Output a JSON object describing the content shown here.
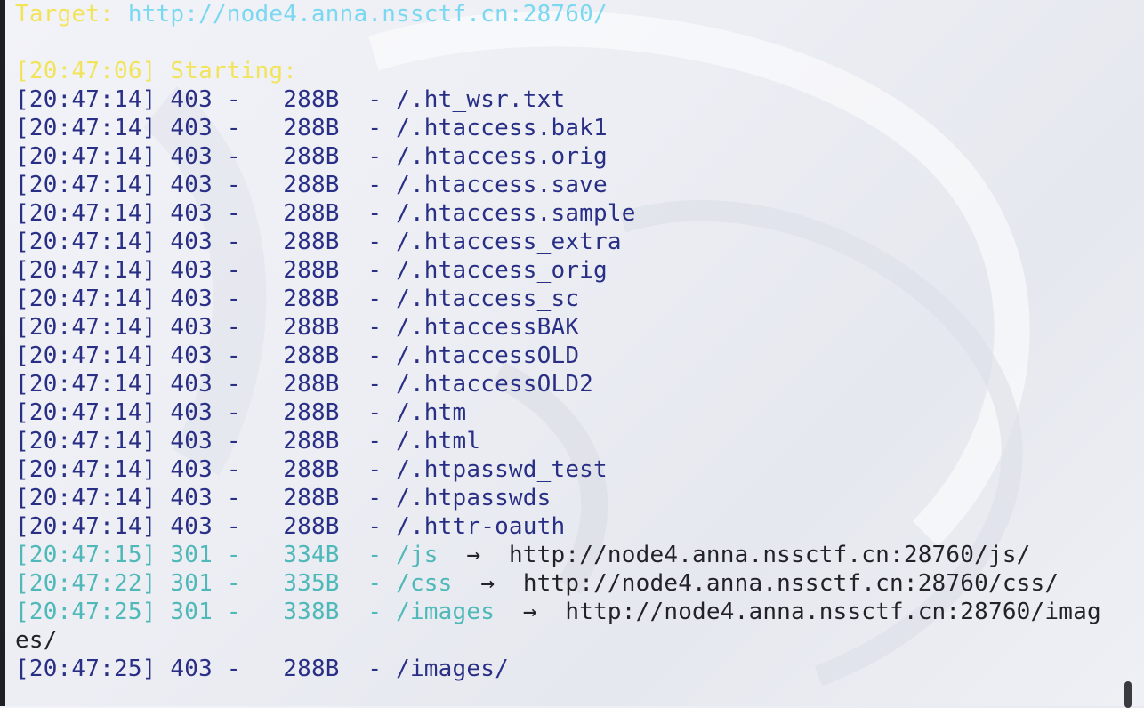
{
  "target": {
    "label": "Target: ",
    "url": "http://node4.anna.nssctf.cn:28760/"
  },
  "start_line": "[20:47:06] Starting:",
  "entries": [
    {
      "time": "[20:47:14]",
      "code": "403",
      "size": "288B",
      "path": "/.ht_wsr.txt"
    },
    {
      "time": "[20:47:14]",
      "code": "403",
      "size": "288B",
      "path": "/.htaccess.bak1"
    },
    {
      "time": "[20:47:14]",
      "code": "403",
      "size": "288B",
      "path": "/.htaccess.orig"
    },
    {
      "time": "[20:47:14]",
      "code": "403",
      "size": "288B",
      "path": "/.htaccess.save"
    },
    {
      "time": "[20:47:14]",
      "code": "403",
      "size": "288B",
      "path": "/.htaccess.sample"
    },
    {
      "time": "[20:47:14]",
      "code": "403",
      "size": "288B",
      "path": "/.htaccess_extra"
    },
    {
      "time": "[20:47:14]",
      "code": "403",
      "size": "288B",
      "path": "/.htaccess_orig"
    },
    {
      "time": "[20:47:14]",
      "code": "403",
      "size": "288B",
      "path": "/.htaccess_sc"
    },
    {
      "time": "[20:47:14]",
      "code": "403",
      "size": "288B",
      "path": "/.htaccessBAK"
    },
    {
      "time": "[20:47:14]",
      "code": "403",
      "size": "288B",
      "path": "/.htaccessOLD"
    },
    {
      "time": "[20:47:14]",
      "code": "403",
      "size": "288B",
      "path": "/.htaccessOLD2"
    },
    {
      "time": "[20:47:14]",
      "code": "403",
      "size": "288B",
      "path": "/.htm"
    },
    {
      "time": "[20:47:14]",
      "code": "403",
      "size": "288B",
      "path": "/.html"
    },
    {
      "time": "[20:47:14]",
      "code": "403",
      "size": "288B",
      "path": "/.htpasswd_test"
    },
    {
      "time": "[20:47:14]",
      "code": "403",
      "size": "288B",
      "path": "/.htpasswds"
    },
    {
      "time": "[20:47:14]",
      "code": "403",
      "size": "288B",
      "path": "/.httr-oauth"
    }
  ],
  "redirects": [
    {
      "time": "[20:47:15]",
      "code": "301",
      "size": "334B",
      "path": "/js",
      "arrow": "→",
      "dest": "http://node4.anna.nssctf.cn:28760/js/"
    },
    {
      "time": "[20:47:22]",
      "code": "301",
      "size": "335B",
      "path": "/css",
      "arrow": "→",
      "dest": "http://node4.anna.nssctf.cn:28760/css/"
    },
    {
      "time": "[20:47:25]",
      "code": "301",
      "size": "338B",
      "path": "/images",
      "arrow": "→",
      "dest": "http://node4.anna.nssctf.cn:28760/imag",
      "dest_wrap": "es/"
    }
  ],
  "last": {
    "time": "[20:47:25]",
    "code": "403",
    "size": "288B",
    "path": "/images/"
  },
  "colors": {
    "prompt_yellow": "#f2e45a",
    "url_cyan": "#7ad8f0",
    "status_403": "#2a2f86",
    "status_301": "#4fb8b8"
  }
}
